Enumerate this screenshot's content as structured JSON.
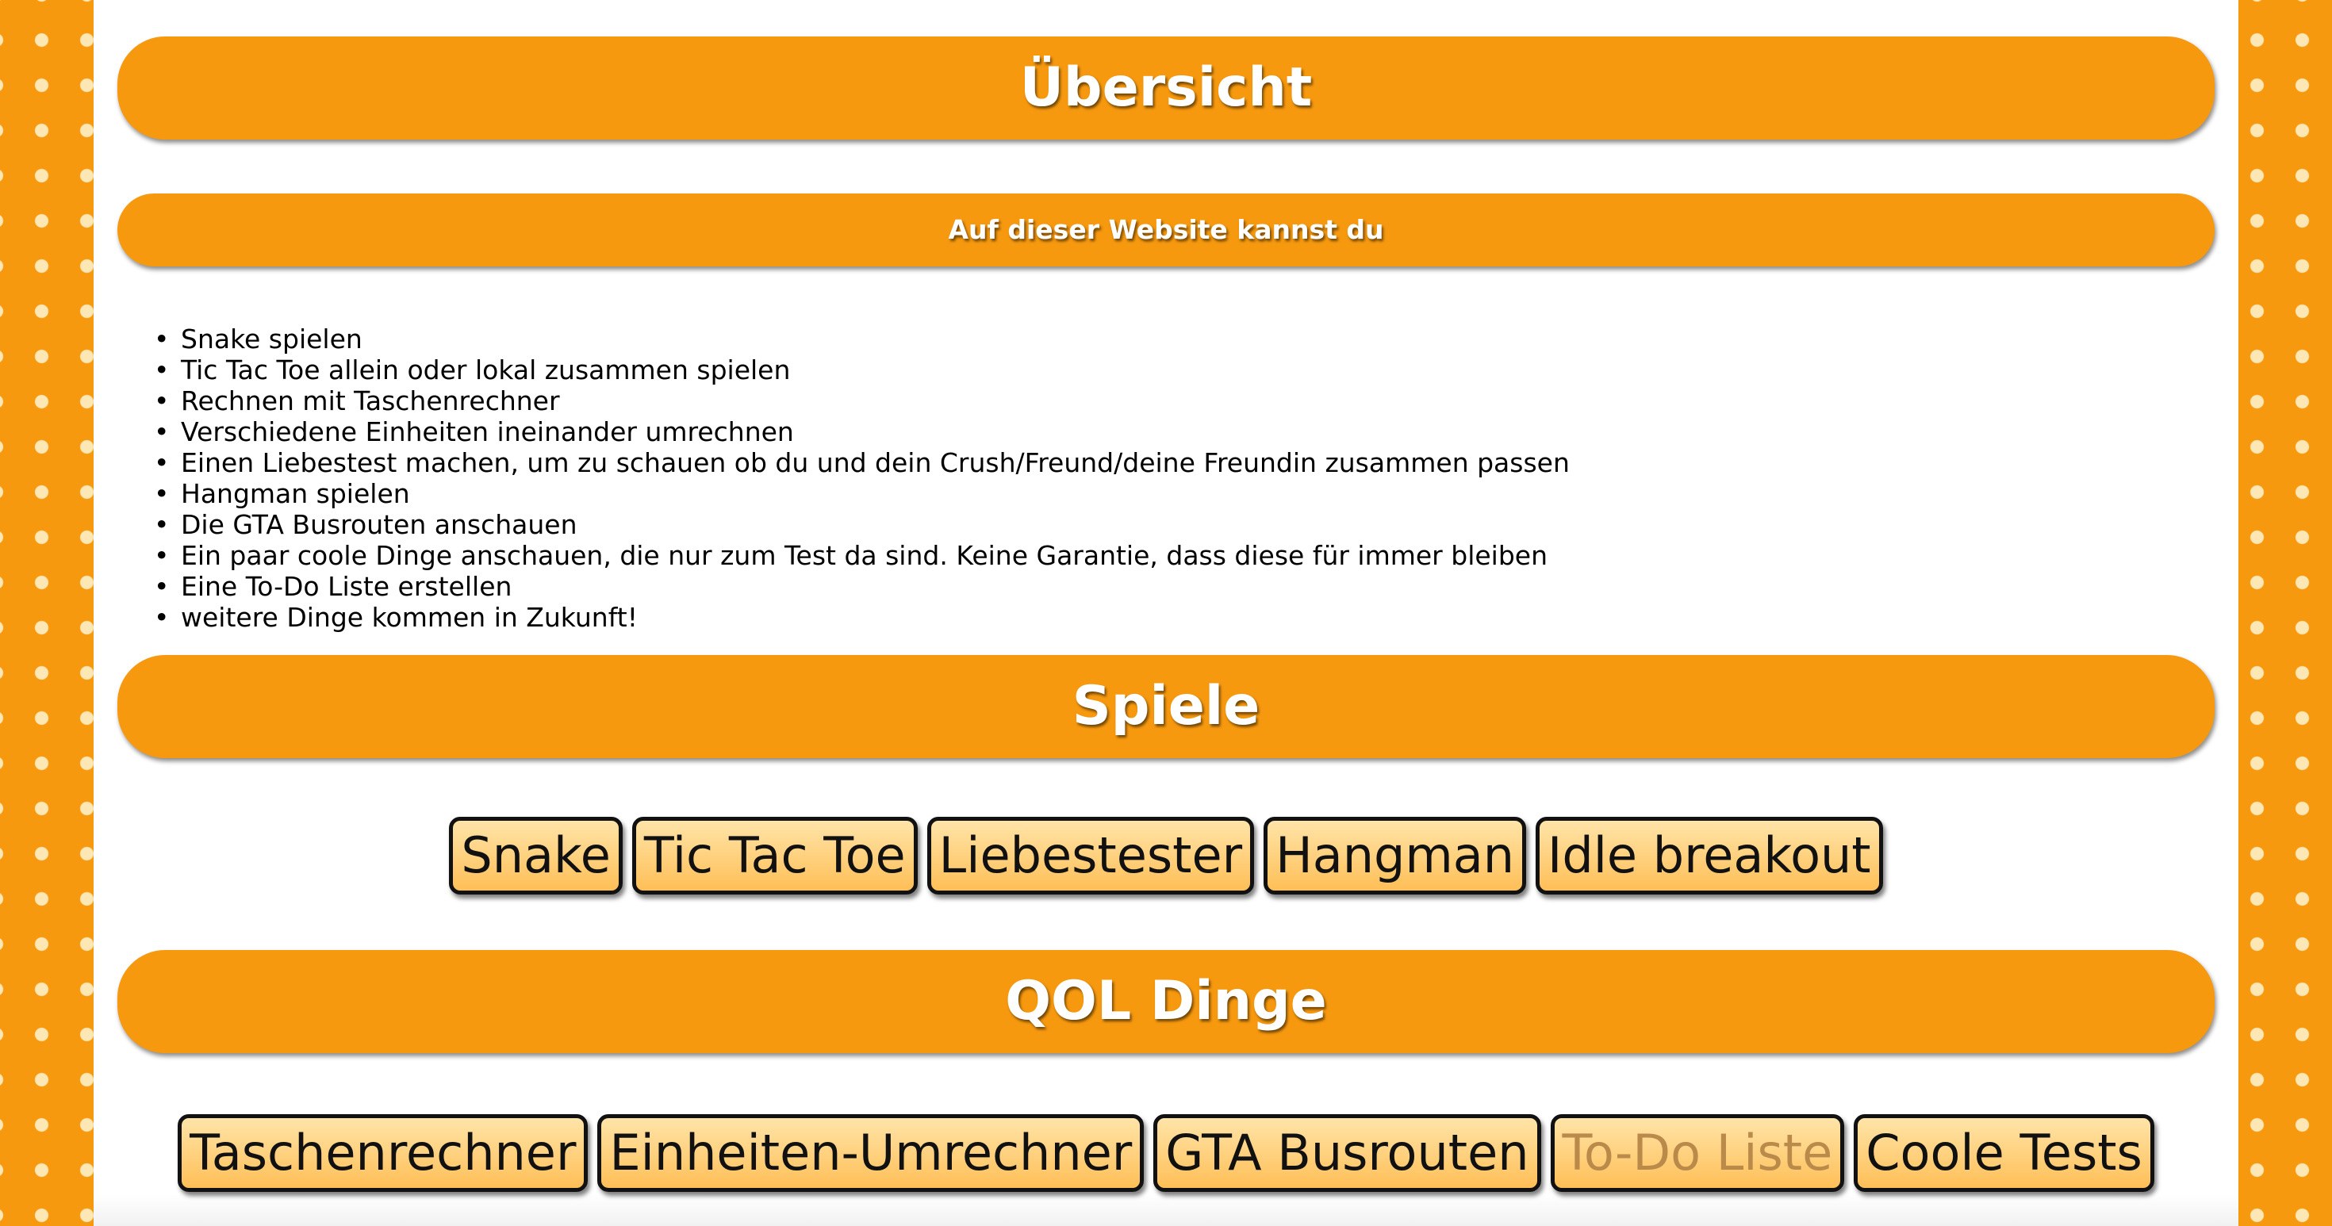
{
  "colors": {
    "orange": "#f7990f",
    "button_top": "#ffe4a8",
    "button_bottom": "#ffbf57",
    "disabled_text": "#b98a4a"
  },
  "overview": {
    "title": "Übersicht",
    "intro_heading": "Auf dieser Website kannst du",
    "items": [
      "Snake spielen",
      "Tic Tac Toe allein oder lokal zusammen spielen",
      "Rechnen mit Taschenrechner",
      "Verschiedene Einheiten ineinander umrechnen",
      "Einen Liebestest machen, um zu schauen ob du und dein Crush/Freund/deine Freundin zusammen passen",
      "Hangman spielen",
      "Die GTA Busrouten anschauen",
      "Ein paar coole Dinge anschauen, die nur zum Test da sind. Keine Garantie, dass diese für immer bleiben",
      "Eine To-Do Liste erstellen",
      "weitere Dinge kommen in Zukunft!"
    ]
  },
  "games": {
    "title": "Spiele",
    "buttons": [
      "Snake",
      "Tic Tac Toe",
      "Liebestester",
      "Hangman",
      "Idle breakout"
    ]
  },
  "qol": {
    "title": "QOL Dinge",
    "buttons": [
      "Taschenrechner",
      "Einheiten-Umrechner",
      "GTA Busrouten",
      "To-Do Liste",
      "Coole Tests"
    ],
    "disabled_button": "To-Do Liste"
  }
}
